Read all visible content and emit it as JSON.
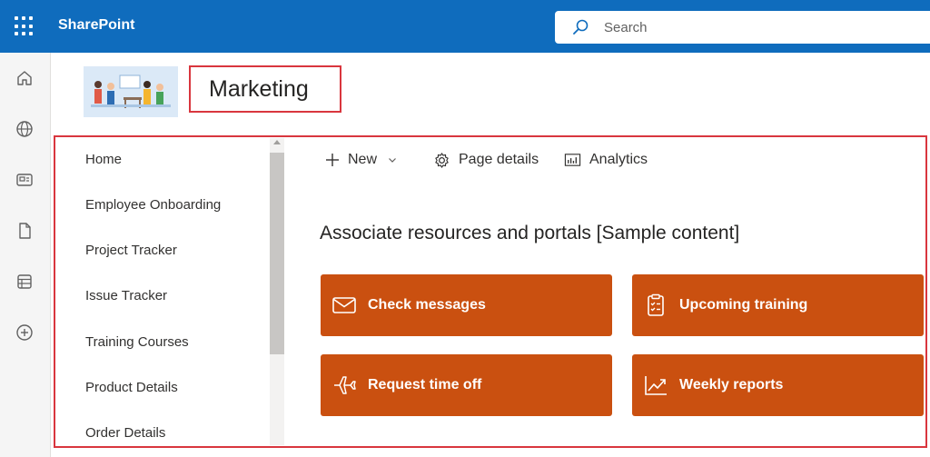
{
  "suite": {
    "app_name": "SharePoint",
    "search_placeholder": "Search",
    "accent": "#0f6cbd"
  },
  "rail": {
    "icons": [
      "home-icon",
      "globe-icon",
      "news-icon",
      "file-icon",
      "list-icon",
      "add-circle-icon"
    ]
  },
  "site": {
    "title": "Marketing"
  },
  "nav": {
    "items": [
      {
        "label": "Home"
      },
      {
        "label": "Employee Onboarding"
      },
      {
        "label": "Project Tracker"
      },
      {
        "label": "Issue Tracker"
      },
      {
        "label": "Training Courses"
      },
      {
        "label": "Product Details"
      },
      {
        "label": "Order Details"
      }
    ]
  },
  "command_bar": {
    "new_label": "New",
    "page_details_label": "Page details",
    "analytics_label": "Analytics"
  },
  "main": {
    "section_title": "Associate resources and portals [Sample content]",
    "tile_color": "#ca5010",
    "tiles": [
      {
        "label": "Check messages",
        "icon": "mail-icon"
      },
      {
        "label": "Upcoming training",
        "icon": "clipboard-icon"
      },
      {
        "label": "Request time off",
        "icon": "airplane-icon"
      },
      {
        "label": "Weekly reports",
        "icon": "trend-chart-icon"
      }
    ]
  },
  "annotation_color": "#d9363e"
}
